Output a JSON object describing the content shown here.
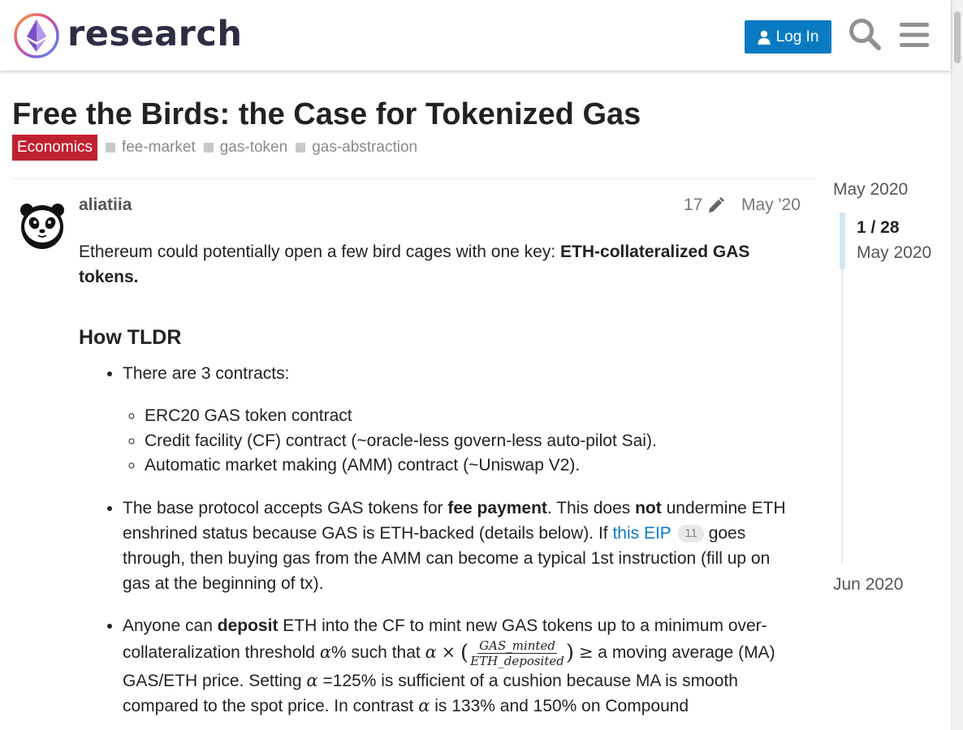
{
  "header": {
    "logo_text": "research",
    "login_label": "Log In",
    "icons": [
      "ethereum-logo-icon",
      "user-icon",
      "search-icon",
      "hamburger-menu-icon"
    ]
  },
  "topic": {
    "title": "Free the Birds: the Case for Tokenized Gas",
    "category": "Economics",
    "tags": [
      "fee-market",
      "gas-token",
      "gas-abstraction"
    ]
  },
  "post": {
    "username": "aliatiia",
    "edit_count": "17",
    "date": "May '20",
    "intro": "Ethereum could potentially open a few bird cages with one key: ",
    "intro_bold": "ETH-collateralized GAS tokens.",
    "heading": "How TLDR",
    "bullet1": "There are 3 contracts:",
    "sub_items": [
      "ERC20 GAS token contract",
      "Credit facility (CF) contract (~oracle-less govern-less auto-pilot Sai).",
      "Automatic market making (AMM) contract (~Uniswap V2)."
    ],
    "bullet2": {
      "t1": "The base protocol accepts GAS tokens for ",
      "b1": "fee payment",
      "t2": ". This does ",
      "b2": "not",
      "t3": " undermine ETH enshrined status because GAS is ETH-backed (details below). If ",
      "link": "this EIP",
      "clicks": "11",
      "t4": " goes through, then buying gas from the AMM can become a typical 1st instruction (fill up on gas at the beginning of tx)."
    },
    "bullet3": {
      "t1": "Anyone can ",
      "b1": "deposit",
      "t2": " ETH into the CF to mint new GAS tokens up to a minimum over-collateralization threshold ",
      "alpha": "α",
      "t3": "% such that ",
      "times": "×",
      "frac_num": "GAS_minted",
      "frac_den": "ETH_deposited",
      "geq": "≥",
      "t4": " a moving average (MA) GAS/ETH price. Setting ",
      "t5": " =125% is sufficient of a cushion because MA is smooth compared to the spot price. In contrast ",
      "t6": " is 133% and 150% on Compound"
    }
  },
  "timeline": {
    "top_date": "May 2020",
    "position": "1 / 28",
    "current_date": "May 2020",
    "bottom_date": "Jun 2020"
  },
  "colors": {
    "primary_button": "#0a7bc2",
    "category": "#c0212f",
    "link": "#0a7bc2",
    "timeline_handle": "#d1e6f3"
  }
}
